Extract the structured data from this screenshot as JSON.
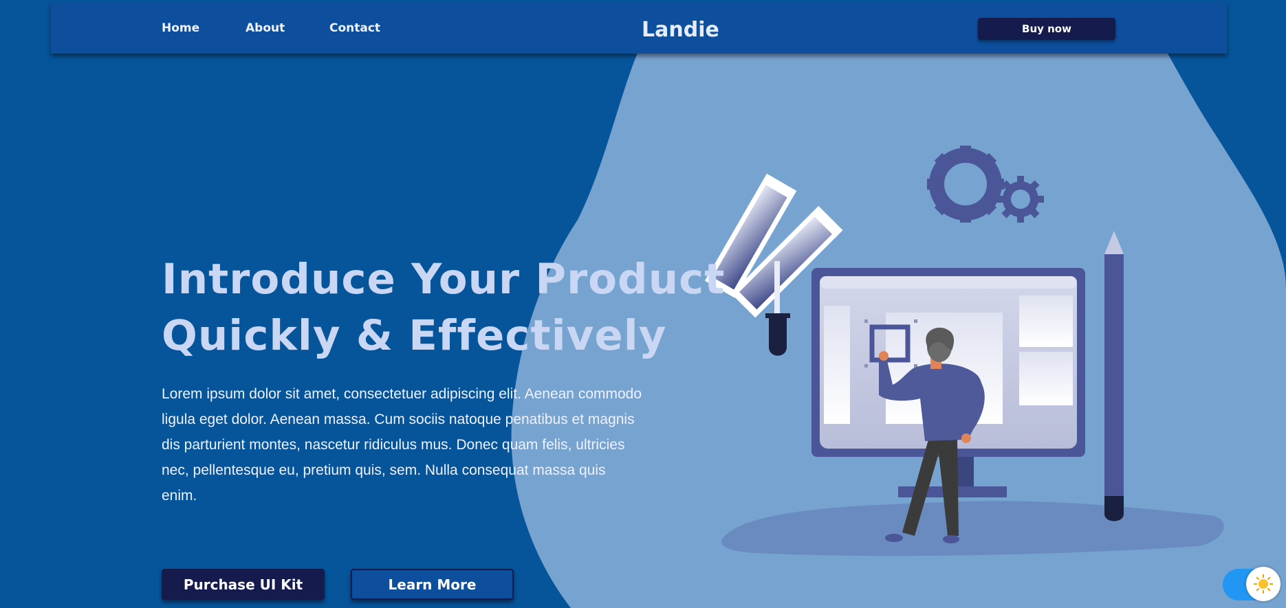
{
  "nav": {
    "links": [
      "Home",
      "About",
      "Contact"
    ],
    "brand": "Landie",
    "cta_label": "Buy now"
  },
  "hero": {
    "title_line1": "Introduce Your Product",
    "title_line2": "Quickly & Effectively",
    "description": "Lorem ipsum dolor sit amet, consectetuer adipiscing elit. Aenean commodo ligula eget dolor. Aenean massa. Cum sociis natoque penatibus et magnis dis parturient montes, nascetur ridiculus mus. Donec quam felis, ultricies nec, pellentesque eu, pretium quis, sem. Nulla consequat massa quis enim.",
    "primary_button": "Purchase UI Kit",
    "secondary_button": "Learn More"
  },
  "theme_toggle": {
    "icon": "sun-icon",
    "state": "on"
  },
  "colors": {
    "background": "#06549a",
    "navbar": "#0d4f9d",
    "blob": "#77a3d0",
    "button_dark": "#151b4d",
    "illustration_accent": "#4a5697",
    "toggle": "#2196f3"
  }
}
